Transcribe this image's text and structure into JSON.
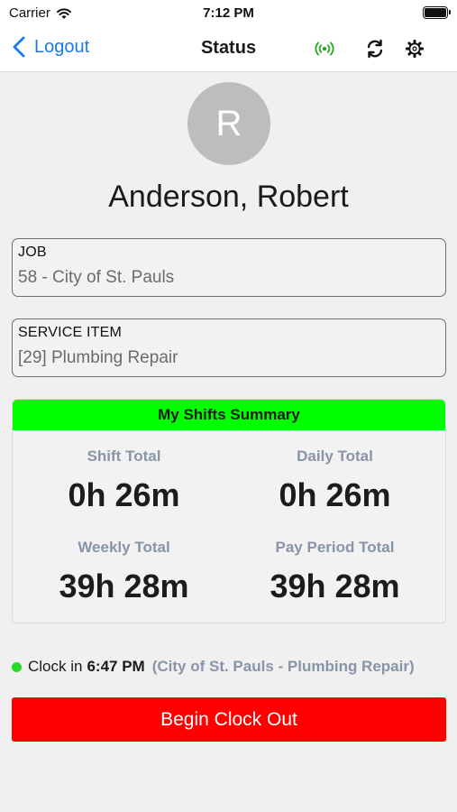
{
  "status_bar": {
    "carrier": "Carrier",
    "time": "7:12 PM",
    "icons": [
      "wifi-icon",
      "battery-icon"
    ]
  },
  "nav": {
    "back_label": "Logout",
    "title": "Status",
    "icons": [
      "signal-icon",
      "refresh-icon",
      "gear-icon"
    ]
  },
  "profile": {
    "initial": "R",
    "name": "Anderson, Robert"
  },
  "job": {
    "label": "JOB",
    "value": "58 - City of St. Pauls"
  },
  "service_item": {
    "label": "SERVICE ITEM",
    "value": "[29] Plumbing Repair"
  },
  "summary": {
    "title": "My Shifts Summary",
    "shift_total_label": "Shift Total",
    "shift_total_value": "0h 26m",
    "daily_total_label": "Daily Total",
    "daily_total_value": "0h 26m",
    "weekly_total_label": "Weekly Total",
    "weekly_total_value": "39h 28m",
    "pay_period_label": "Pay Period Total",
    "pay_period_value": "39h 28m"
  },
  "clock": {
    "prefix": "Clock in",
    "time": "6:47 PM",
    "detail": "(City of St. Pauls - Plumbing Repair)"
  },
  "action": {
    "clock_out_label": "Begin Clock Out"
  },
  "colors": {
    "accent_blue": "#1a7be6",
    "summary_header": "#00ff00",
    "online_green": "#22aa22",
    "clock_out_red": "#ff0000"
  }
}
